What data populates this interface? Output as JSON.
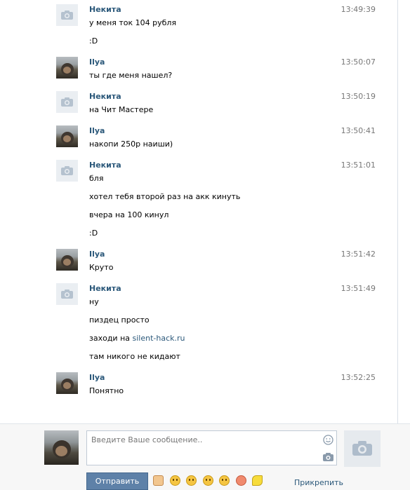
{
  "messages": [
    {
      "author": "Некита",
      "avatar": "camera-placeholder",
      "time": "13:49:39",
      "lines": [
        "у меня ток 104 рубля",
        ":D"
      ]
    },
    {
      "author": "Ilya",
      "avatar": "photo",
      "time": "13:50:07",
      "lines": [
        "ты где меня нашел?"
      ]
    },
    {
      "author": "Некита",
      "avatar": "camera-placeholder",
      "time": "13:50:19",
      "lines": [
        "на Чит Мастере"
      ]
    },
    {
      "author": "Ilya",
      "avatar": "photo",
      "time": "13:50:41",
      "lines": [
        "накопи 250р наиши)"
      ]
    },
    {
      "author": "Некита",
      "avatar": "camera-placeholder",
      "time": "13:51:01",
      "lines": [
        "бля",
        "хотел тебя второй раз на акк кинуть",
        "вчера на 100 кинул",
        ":D"
      ]
    },
    {
      "author": "Ilya",
      "avatar": "photo",
      "time": "13:51:42",
      "lines": [
        "Круто"
      ]
    },
    {
      "author": "Некита",
      "avatar": "camera-placeholder",
      "time": "13:51:49",
      "lines": [
        "ну",
        "пиздец просто",
        "заходи на ",
        "там никого не кидают"
      ],
      "link": "silent-hack.ru"
    },
    {
      "author": "Ilya",
      "avatar": "photo",
      "time": "13:52:25",
      "lines": [
        "Понятно"
      ]
    }
  ],
  "composer": {
    "placeholder": "Введите Ваше сообщение..",
    "send_label": "Отправить",
    "attach_label": "Прикрепить",
    "emojis": [
      "thumbs-up",
      "laughing",
      "neutral",
      "smile",
      "wink",
      "peach",
      "banana"
    ]
  },
  "colors": {
    "author": "#2b587a",
    "send_button": "#5e81a8",
    "link": "#2b587a"
  }
}
